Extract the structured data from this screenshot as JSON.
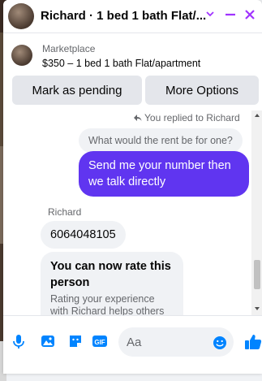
{
  "header": {
    "title": "Richard · 1 bed 1 bath Flat/..."
  },
  "marketplace": {
    "label": "Marketplace",
    "item": "$350 – 1 bed 1 bath Flat/apartment"
  },
  "actions": {
    "pending": "Mark as pending",
    "more": "More Options"
  },
  "messages": {
    "replied_note": "You replied to Richard",
    "quoted": "What would the rent be for one?",
    "mine": "Send me your number then we talk directly",
    "sender": "Richard",
    "number": "6064048105",
    "rate_title": "You can now rate this person",
    "rate_body": "Rating your experience with Richard helps others"
  },
  "composer": {
    "placeholder": "Aa"
  },
  "colors": {
    "accent": "#a033ff",
    "bubble_mine": "#6035f0",
    "icon": "#0084ff"
  }
}
